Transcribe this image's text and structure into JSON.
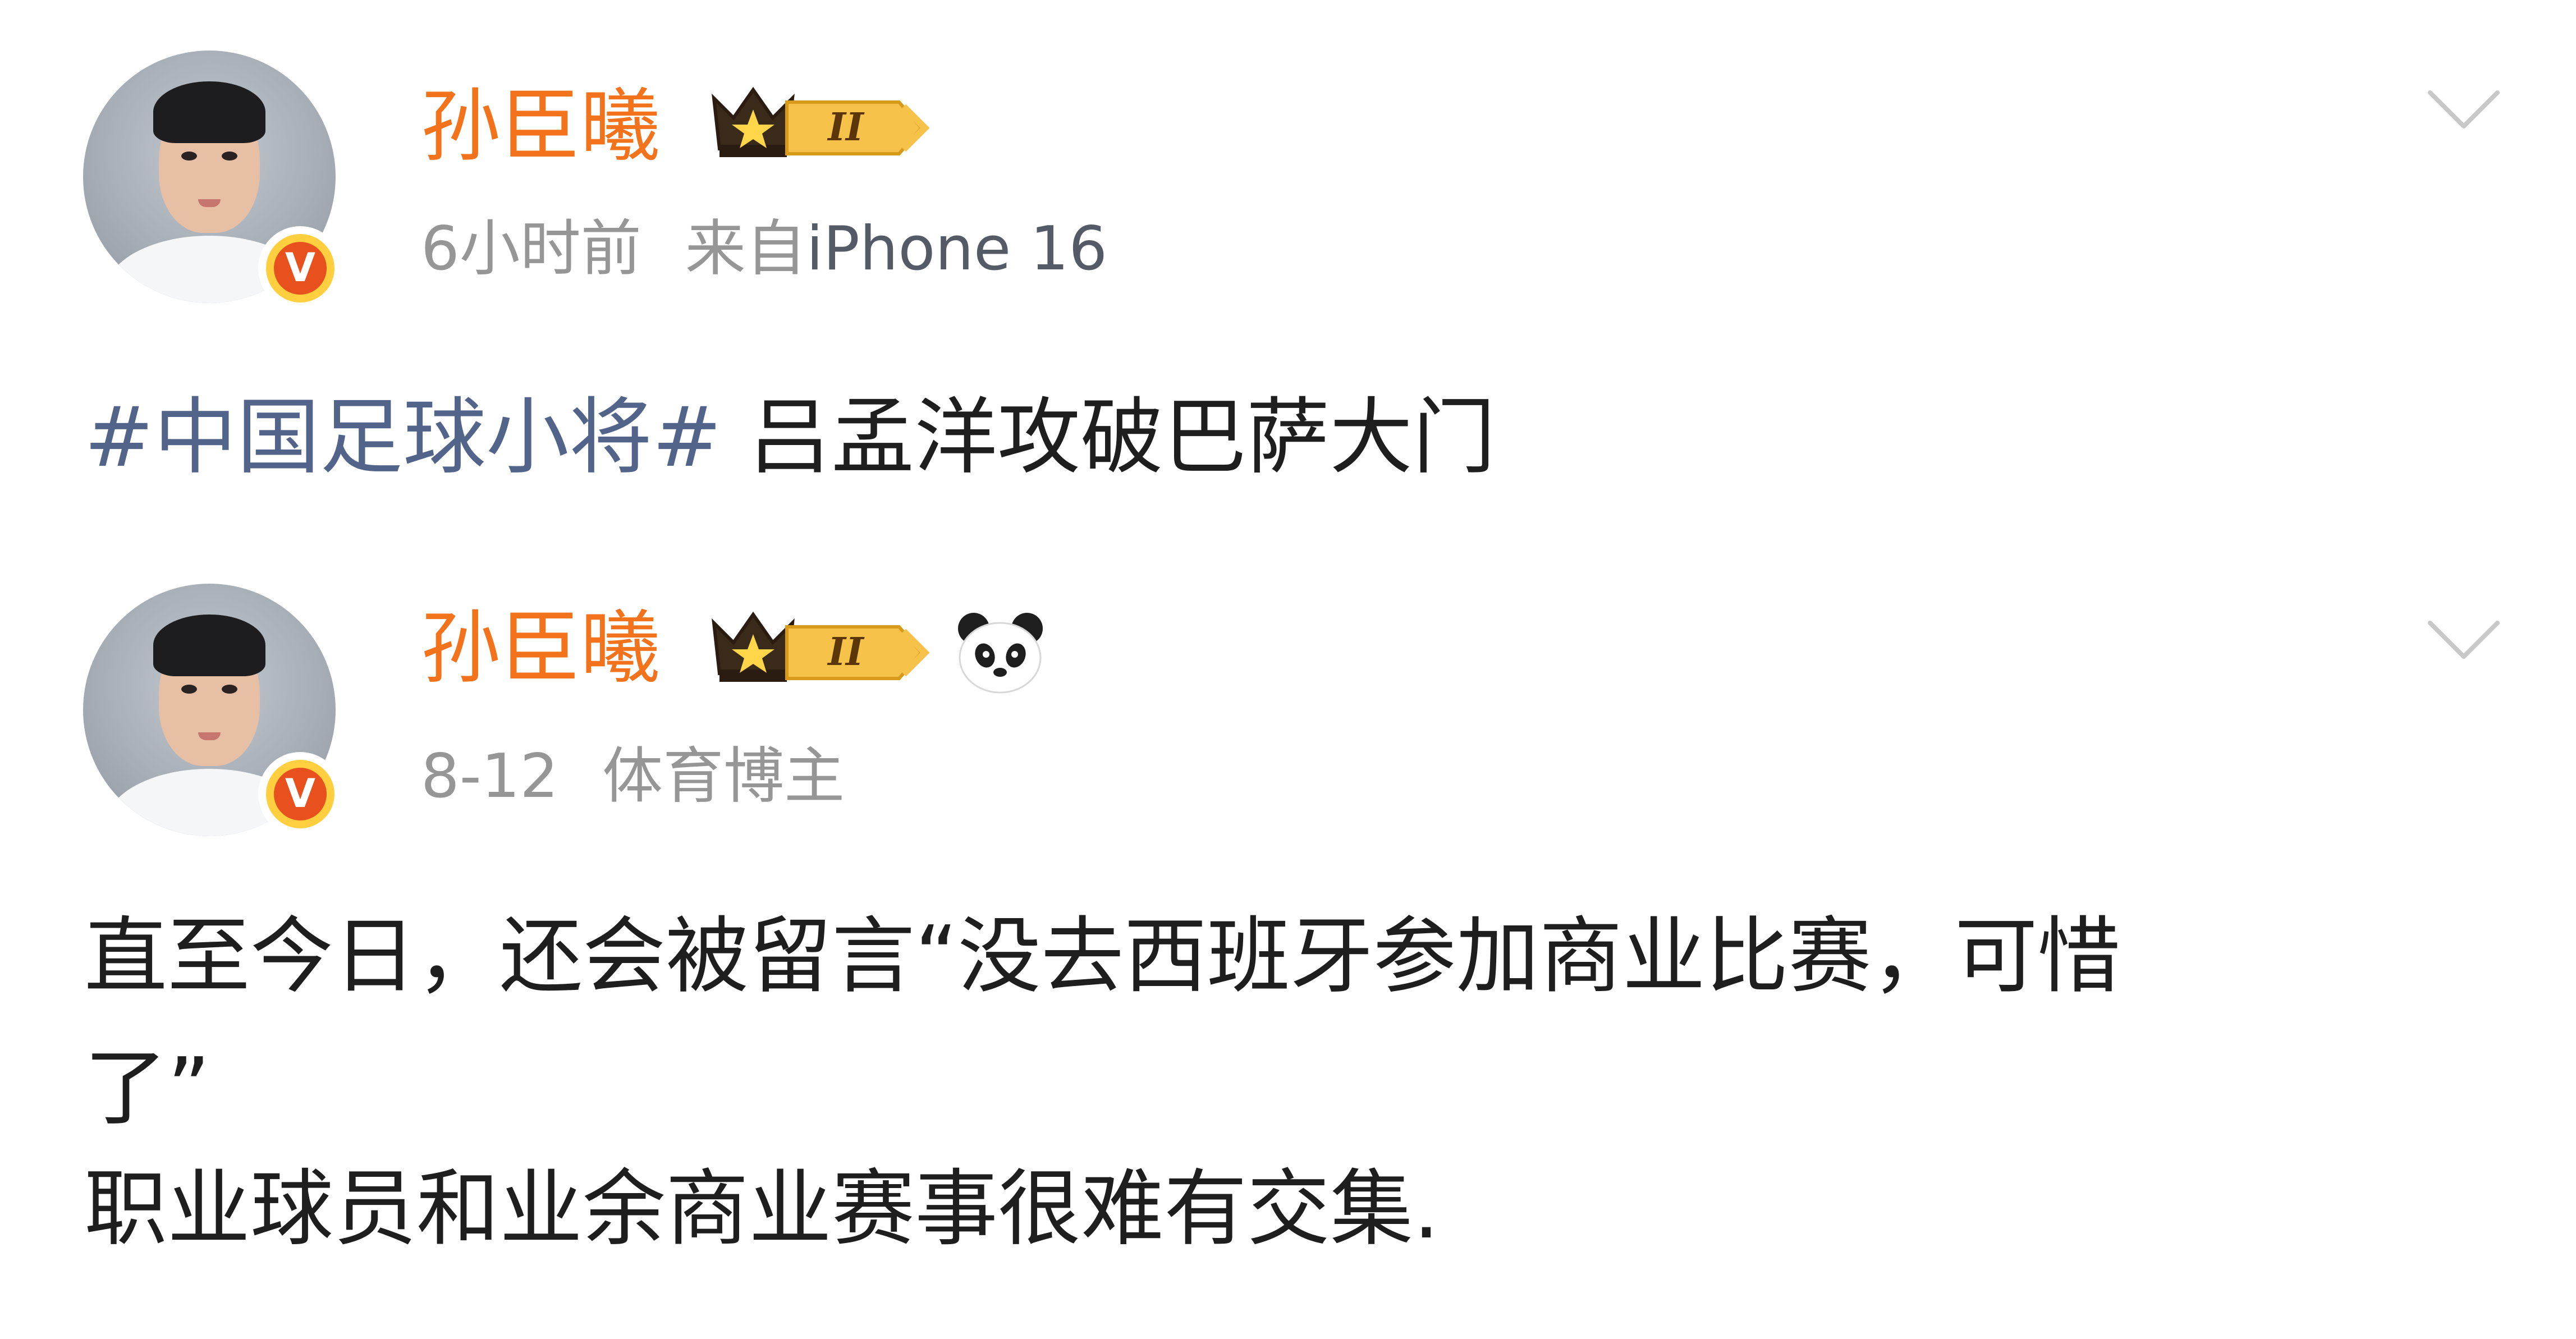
{
  "posts": [
    {
      "username": "孙臣曦",
      "verified_badge": "V",
      "vip_level_badge": "II",
      "icons": [
        "crown-icon",
        "vip-level-badge",
        "verified-v-badge",
        "chevron-down-icon"
      ],
      "time": "6小时前",
      "source_prefix": "来自",
      "source": "iPhone 16",
      "hashtag": "#中国足球小将#",
      "text": " 吕孟洋攻破巴萨大门"
    },
    {
      "username": "孙臣曦",
      "verified_badge": "V",
      "vip_level_badge": "II",
      "icons": [
        "crown-icon",
        "vip-level-badge",
        "panda-icon",
        "verified-v-badge",
        "chevron-down-icon"
      ],
      "time": "8-12",
      "tag": "体育博主",
      "lines": [
        "直至今日，还会被留言“没去西班牙参加商业比赛，可惜",
        "了”",
        "职业球员和业余商业赛事很难有交集."
      ]
    }
  ],
  "colors": {
    "username": "#f3731d",
    "meta": "#969696",
    "hashtag": "#52648a",
    "text": "#1e1e1e",
    "verified_badge_outer": "#ffcf3f",
    "verified_badge_inner": "#e8501e",
    "vip_gold": "#f6c24a",
    "chevron": "#c8c8c8"
  }
}
